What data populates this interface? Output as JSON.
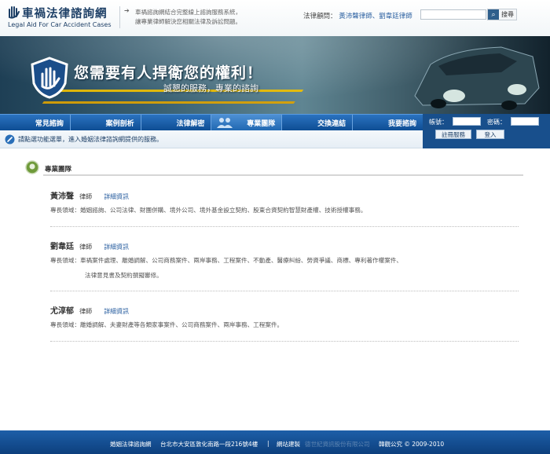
{
  "header": {
    "logo_title": "車禍法律諮詢網",
    "logo_sub": "Legal Aid For Car Accident Cases",
    "intro_line1": "車禍諮詢網結合完整線上諮詢服務系統，",
    "intro_line2": "讓專業律師解決您相關法律及訴訟問題。",
    "advisor_label": "法律顧問：",
    "advisor_names": "黃沛聲律師、劉韋廷律師",
    "search_value": "",
    "search_button": "搜尋"
  },
  "banner": {
    "title": "您需要有人捍衛您的權利！",
    "subtitle": "誠懇的服務，專業的諮詢"
  },
  "nav": {
    "items": [
      {
        "label": "常見諮詢"
      },
      {
        "label": "案例剖析"
      },
      {
        "label": "法律解密"
      },
      {
        "label": "專業團隊"
      },
      {
        "label": "交換連結"
      },
      {
        "label": "我要諮詢"
      }
    ],
    "active_index": 3
  },
  "login": {
    "account_label": "帳號：",
    "password_label": "密碼：",
    "register_button": "註冊服務",
    "login_button": "登入"
  },
  "notice": {
    "text": "請點選功能選單，進入婚姻法律諮詢網提供的服務。"
  },
  "section": {
    "title": "專業團隊"
  },
  "lawyers": [
    {
      "name": "黃沛聲",
      "title": "律師",
      "detail": "詳細資訊",
      "spec1": "專長領域：婚姻諮詢、公司法律、財團併購、境外公司、境外基金設立契約、股東合資契約智慧財產權、技術授權事務。",
      "spec2": ""
    },
    {
      "name": "劉韋廷",
      "title": "律師",
      "detail": "詳細資訊",
      "spec1": "專長領域：車禍案件處理、離婚調解、公司商務案件、兩岸事務、工程案件、不動產、醫療糾紛、勞資爭議、商標、專利著作權案件、",
      "spec2": "法律意見書及契約撰擬審修。"
    },
    {
      "name": "尤淳郁",
      "title": "律師",
      "detail": "詳細資訊",
      "spec1": "專長領域：離婚調解、夫妻財產等各類家事案件、公司商務案件、兩岸事務、工程案件。",
      "spec2": ""
    }
  ],
  "footer": {
    "site": "婚姻法律諮詢網",
    "address": "台北市大安區敦化南路一段216號4樓",
    "sep": "|",
    "build_label": "網站建製",
    "builder": "德世紀資訊股份有限公司",
    "copyright": "韓觀公究 © 2009-2010"
  },
  "colors": {
    "nav_blue": "#0e4d94",
    "link_blue": "#2a5fa0",
    "footer_blue": "#1d5fa8"
  }
}
